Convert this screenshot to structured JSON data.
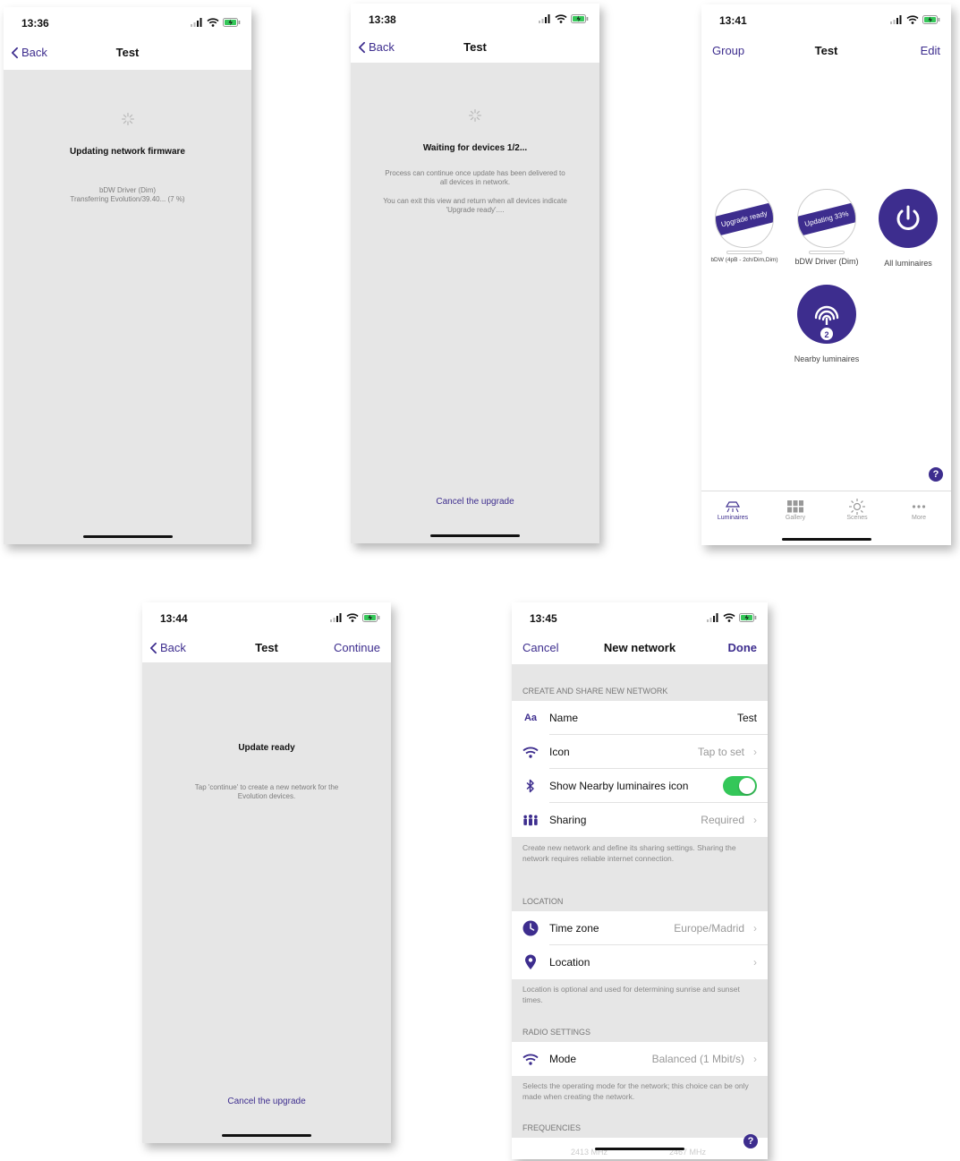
{
  "screen1": {
    "time": "13:36",
    "back": "Back",
    "title": "Test",
    "heading": "Updating network firmware",
    "device": "bDW Driver (Dim)",
    "transfer": "Transferring Evolution/39.40... (7 %)"
  },
  "screen2": {
    "time": "13:38",
    "back": "Back",
    "title": "Test",
    "heading": "Waiting for devices 1/2...",
    "line1": "Process can continue once update has been delivered to",
    "line2": "all devices in network.",
    "line3": "You can exit this view and return when all devices indicate",
    "line4": "'Upgrade ready'....",
    "cancel": "Cancel the upgrade"
  },
  "screen3": {
    "time": "13:41",
    "left": "Group",
    "title": "Test",
    "right": "Edit",
    "lum1_banner": "Upgrade ready",
    "lum1_label": "bDW (4pB - 2ch/Dim,Dim)",
    "lum2_banner": "Updating 33%",
    "lum2_label": "bDW Driver (Dim)",
    "lum3_label": "All luminaires",
    "nearby_count": "2",
    "nearby_label": "Nearby luminaires",
    "help": "?",
    "tabs": [
      "Luminaires",
      "Gallery",
      "Scenes",
      "More"
    ]
  },
  "screen4": {
    "time": "13:44",
    "back": "Back",
    "title": "Test",
    "right": "Continue",
    "heading": "Update ready",
    "line1": "Tap 'continue' to create a new network for the",
    "line2": "Evolution devices.",
    "cancel": "Cancel the upgrade"
  },
  "screen5": {
    "time": "13:45",
    "left": "Cancel",
    "title": "New network",
    "right": "Done",
    "sec1": "CREATE AND SHARE NEW NETWORK",
    "name_label": "Name",
    "name_value": "Test",
    "name_icon": "Aa",
    "icon_label": "Icon",
    "icon_value": "Tap to set",
    "nearby_label": "Show Nearby luminaires icon",
    "sharing_label": "Sharing",
    "sharing_value": "Required",
    "note1": "Create new network and define its sharing settings. Sharing the network requires reliable internet connection.",
    "sec2": "LOCATION",
    "tz_label": "Time zone",
    "tz_value": "Europe/Madrid",
    "loc_label": "Location",
    "note2": "Location is optional and used for determining sunrise and sunset times.",
    "sec3": "RADIO SETTINGS",
    "mode_label": "Mode",
    "mode_value": "Balanced (1 Mbit/s)",
    "note3": "Selects the operating mode for the network; this choice can be only made when creating the network.",
    "sec4": "FREQUENCIES",
    "freq1": "2413 MHz",
    "freq2": "2467 MHz",
    "help": "?"
  },
  "colors": {
    "accent": "#3d2d8e",
    "background": "#e6e6e6",
    "toggle_on": "#34c759"
  },
  "icons": [
    "back-chevron-icon",
    "signal-icon",
    "wifi-icon",
    "battery-icon",
    "spinner-icon",
    "power-icon",
    "nearby-icon",
    "luminaires-tab-icon",
    "gallery-tab-icon",
    "scenes-tab-icon",
    "more-tab-icon",
    "help-icon",
    "wifi-row-icon",
    "bluetooth-icon",
    "sharing-people-icon",
    "clock-icon",
    "location-pin-icon",
    "chevron-right-icon"
  ]
}
